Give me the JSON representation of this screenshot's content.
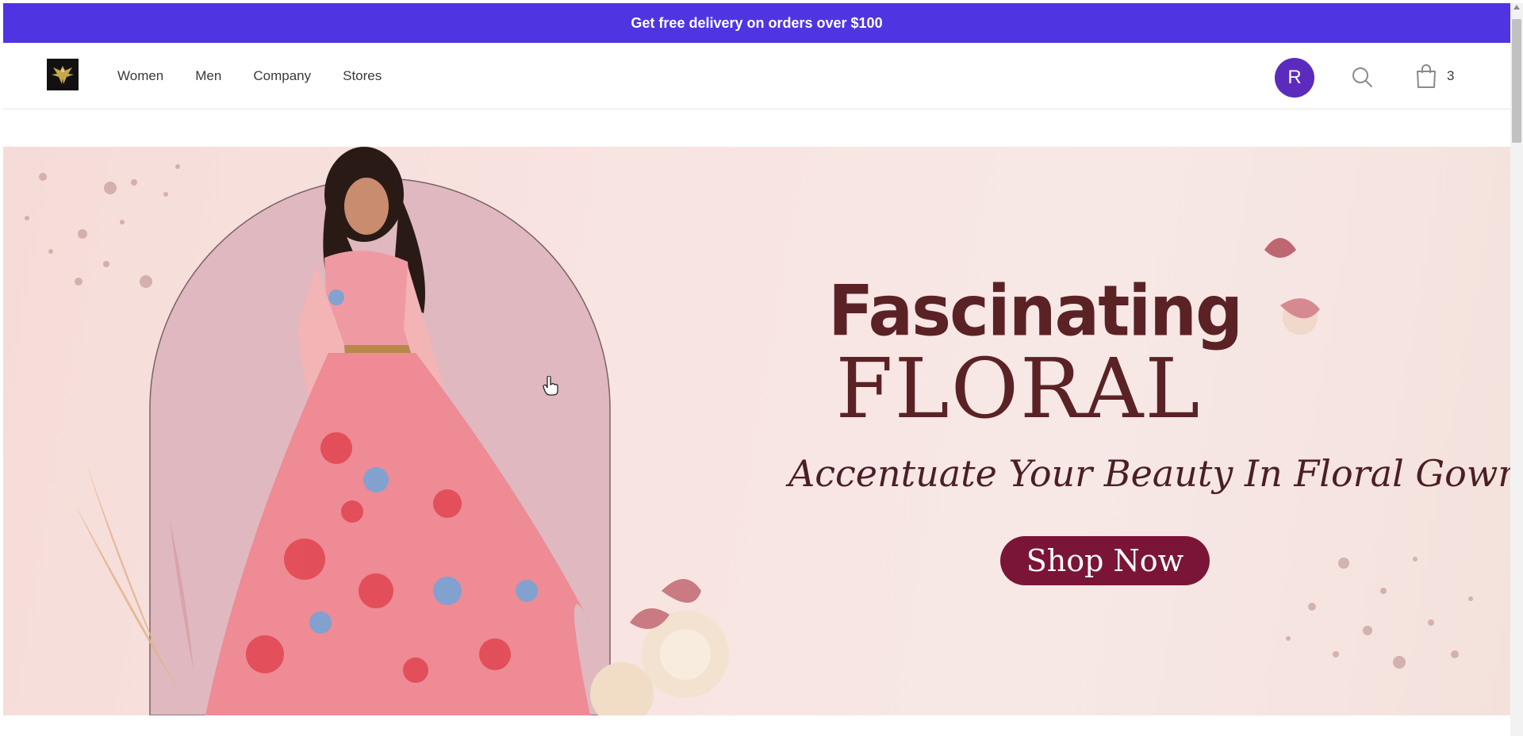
{
  "promo": {
    "text": "Get free delivery on orders over $100",
    "color": "#4f35e2"
  },
  "header": {
    "logo_icon": "eagle-logo-icon",
    "nav": [
      "Women",
      "Men",
      "Company",
      "Stores"
    ],
    "avatar_initial": "R",
    "avatar_color": "#5b2bbd",
    "search_icon": "search-icon",
    "cart_icon": "shopping-bag-icon",
    "cart_count": "3"
  },
  "hero": {
    "title_line1": "Fascinating",
    "title_line2": "FLORAL",
    "tagline": "Accentuate Your Beauty In Floral Gowns.",
    "cta": "Shop Now",
    "cta_color": "#7b1538",
    "image_description_icon": "model-in-floral-gown-image"
  }
}
